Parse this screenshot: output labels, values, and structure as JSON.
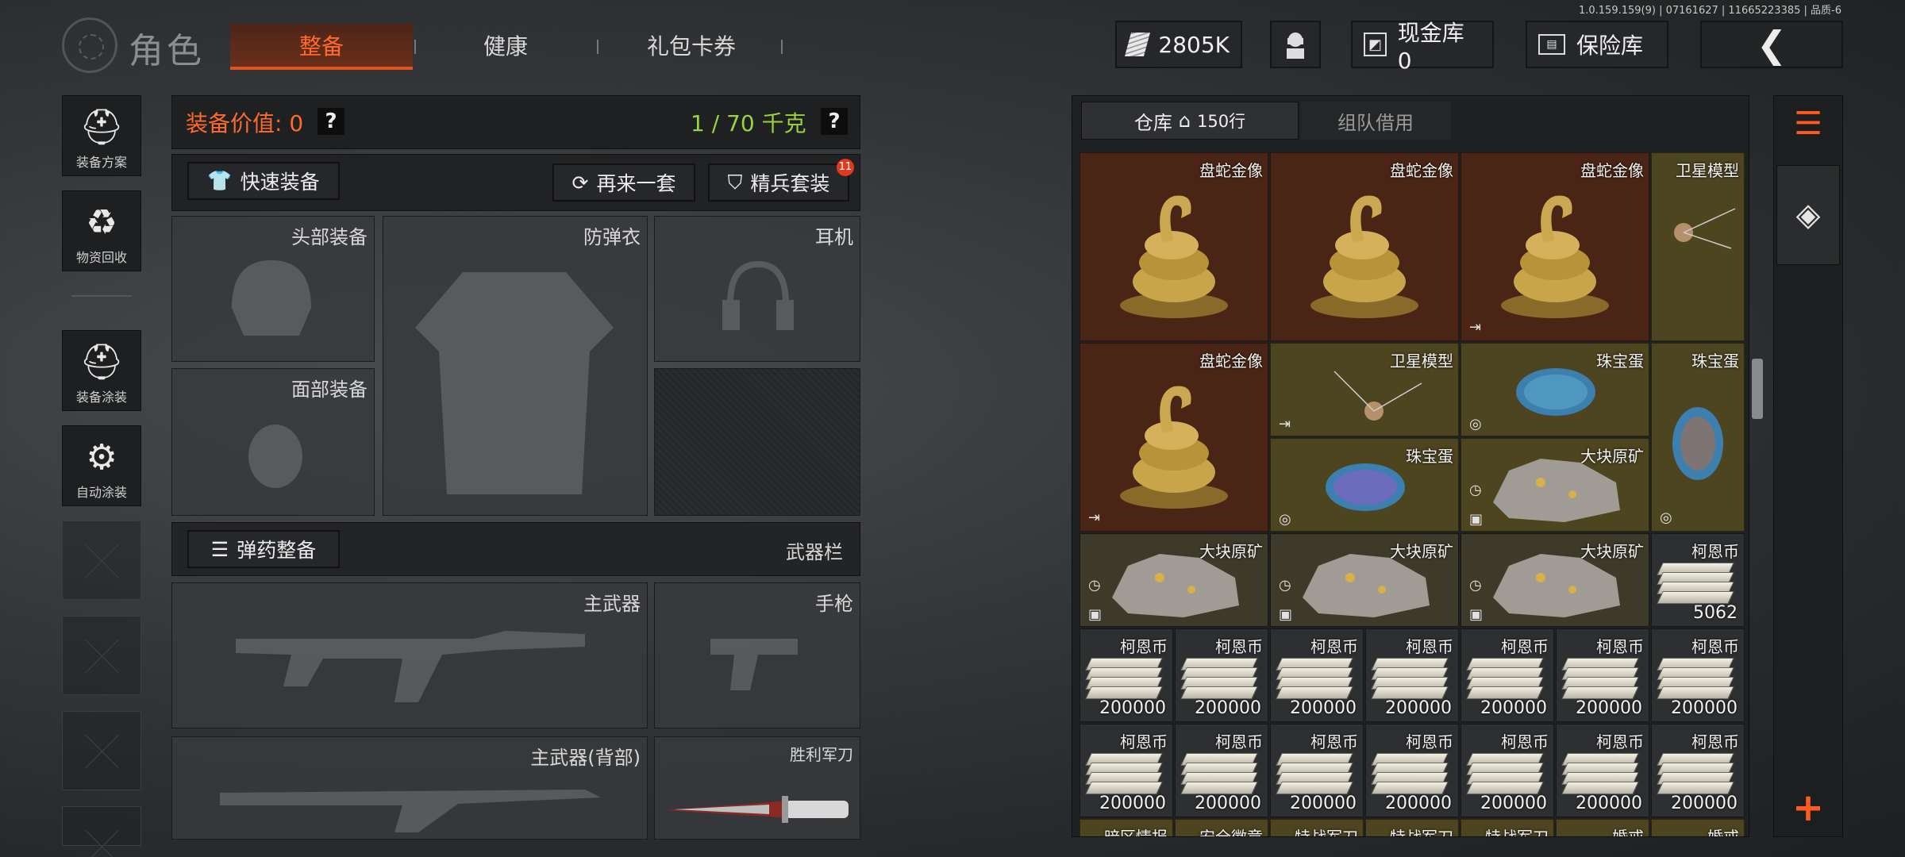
{
  "version": "1.0.159.159(9) | 07161627 | 11665223385 | 品质-6",
  "header": {
    "title": "角色",
    "tabs": [
      {
        "label": "整备",
        "active": true
      },
      {
        "label": "健康",
        "active": false
      },
      {
        "label": "礼包卡券",
        "active": false
      }
    ],
    "cash": "2805K",
    "vault_cash": "现金库 0",
    "safe": "保险库",
    "icons": {
      "cash": "cash-icon",
      "support": "support-agent-icon",
      "back": "back-arrow-icon"
    }
  },
  "sidebar": {
    "items": [
      {
        "label": "装备方案",
        "icon": "helmet-icon"
      },
      {
        "label": "物资回收",
        "icon": "recycle-icon"
      },
      {
        "label": "装备涂装",
        "icon": "paint-helmet-icon"
      },
      {
        "label": "自动涂装",
        "icon": "brush-gear-icon"
      }
    ]
  },
  "equipment": {
    "value_label": "装备价值: 0",
    "weight_label": "1 / 70 千克",
    "quick_equip": "快速装备",
    "redo": "再来一套",
    "elite": "精兵套装",
    "elite_badge": "11",
    "slots": {
      "head": "头部装备",
      "vest": "防弹衣",
      "headset": "耳机",
      "face": "面部装备"
    },
    "ammo": "弹药整备",
    "weapon_bar": "武器栏",
    "weapons": {
      "primary": "主武器",
      "pistol": "手枪",
      "primary_back": "主武器(背部)",
      "knife": "胜利军刀"
    }
  },
  "warehouse": {
    "tab_main": "仓库",
    "tab_main_count": "150行",
    "tab_team": "组队借用",
    "items": {
      "snake": "盘蛇金像",
      "satellite": "卫星模型",
      "egg": "珠宝蛋",
      "ore": "大块原矿",
      "coin": "柯恩币"
    },
    "coin_big_qty": "5062",
    "coin_qty": "200000",
    "bottom_row": [
      "暗区情报",
      "安全徽章",
      "特战军刀",
      "特战军刀",
      "特战军刀",
      "婚戒",
      "婚戒"
    ]
  },
  "colors": {
    "accent": "#ff6a2a",
    "weight_green": "#9ad23c",
    "red_rarity": "#4a2515",
    "gold_rarity": "#4d4420"
  }
}
